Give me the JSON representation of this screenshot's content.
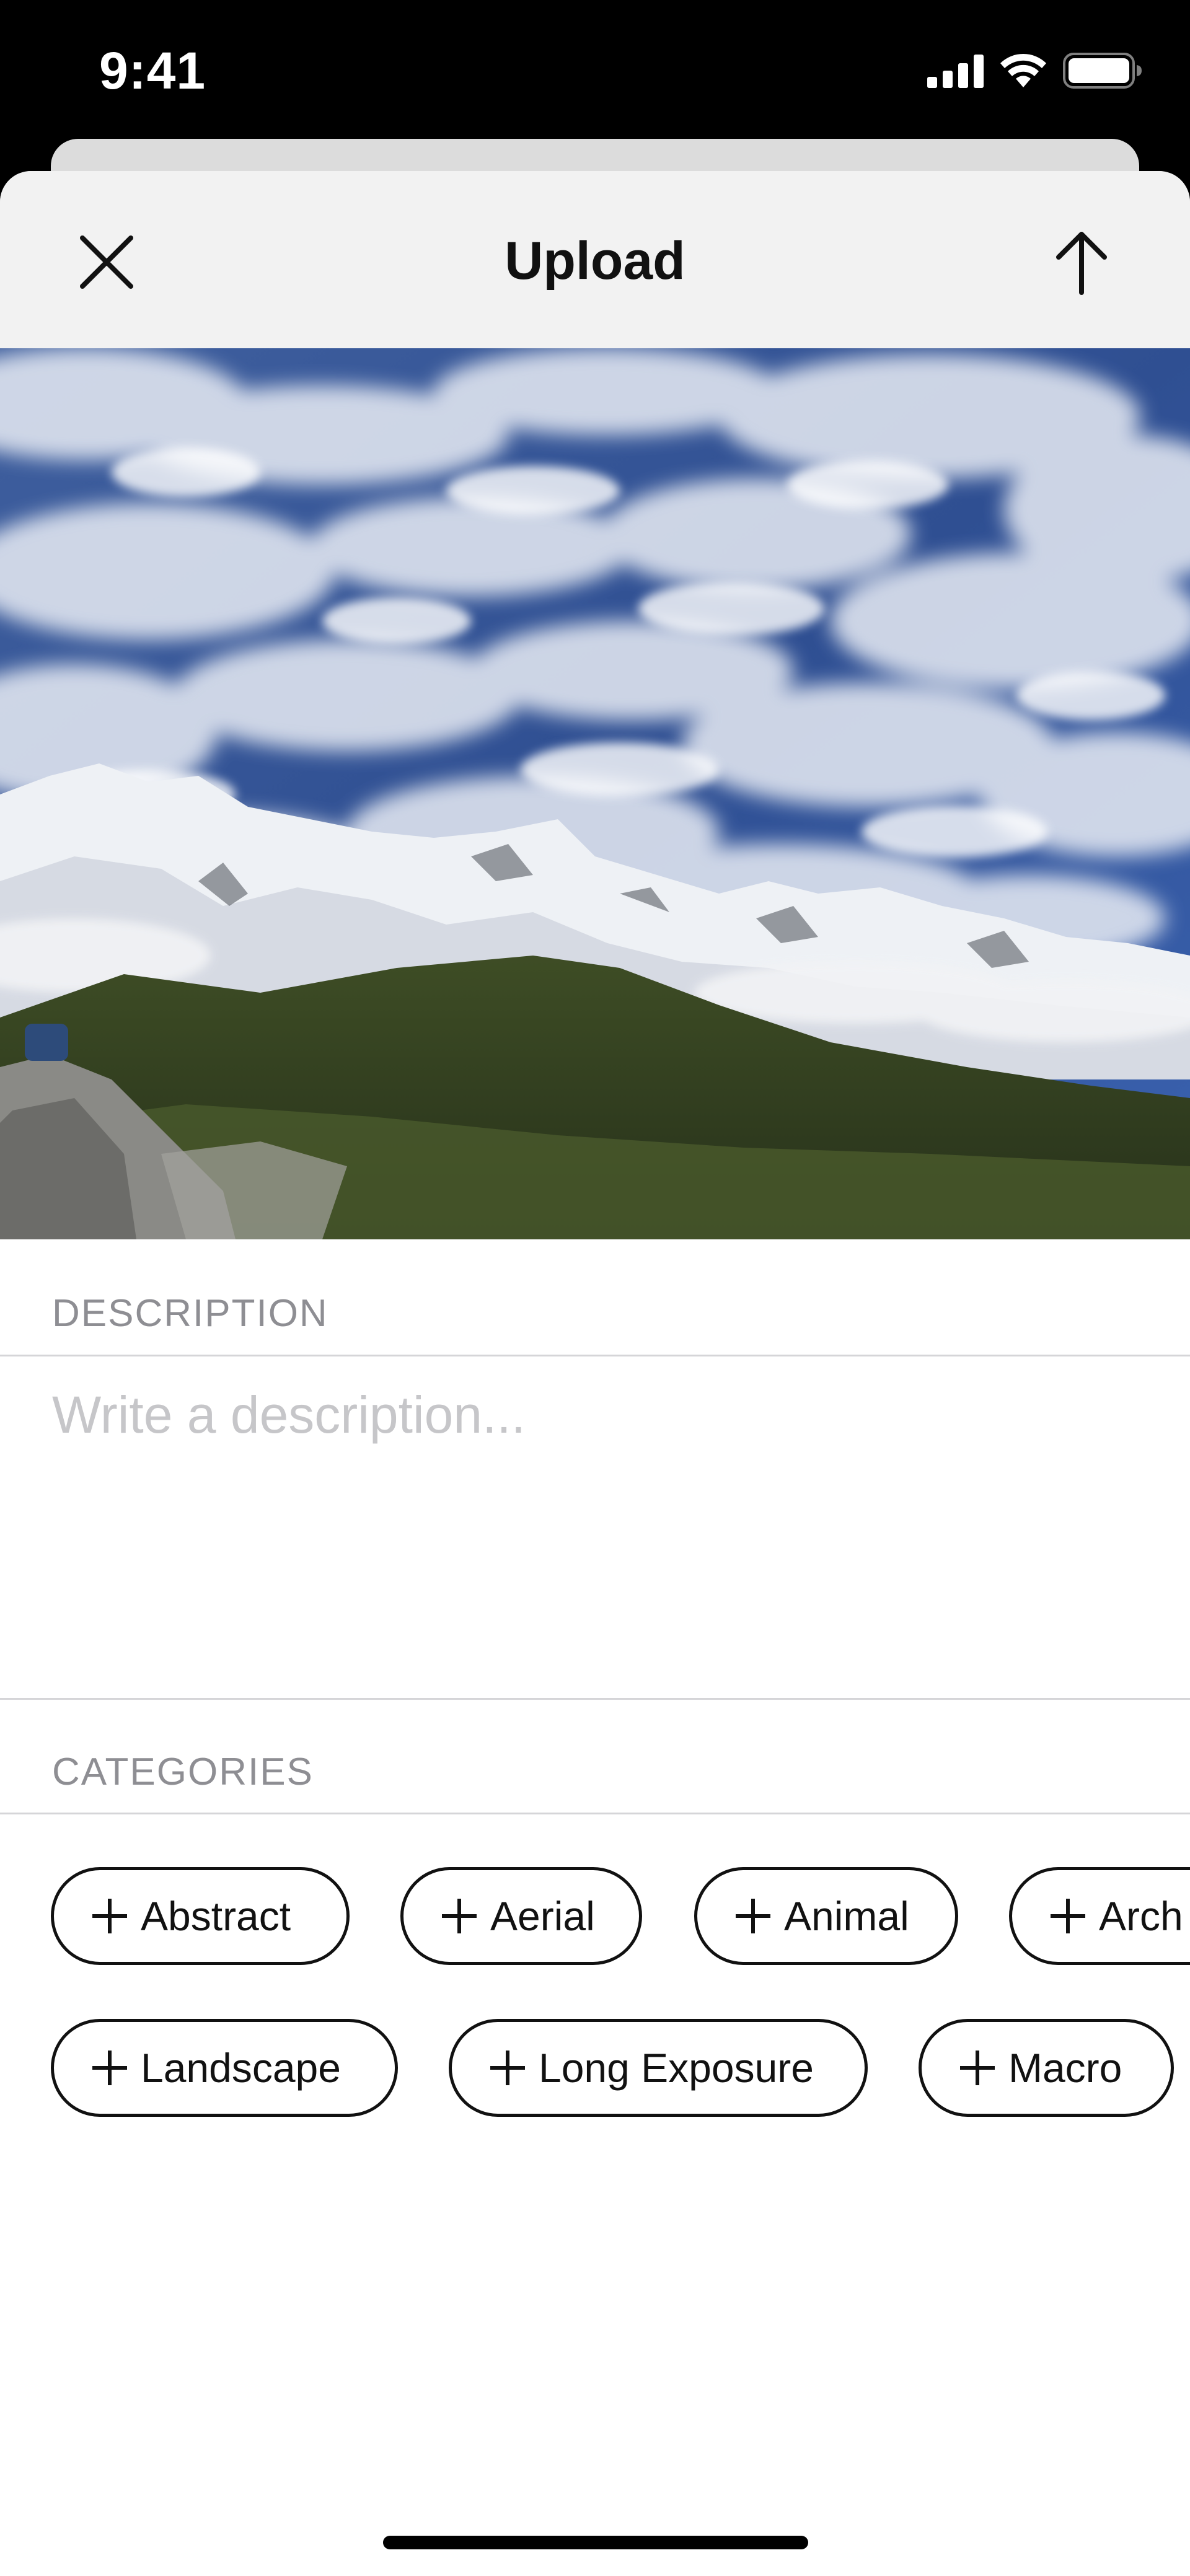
{
  "status_bar": {
    "time": "9:41"
  },
  "nav": {
    "title": "Upload",
    "close_icon": "close-icon",
    "upload_icon": "arrow-up-icon"
  },
  "photo": {
    "subject": "snowy mountain range under a cloudy blue sky"
  },
  "description": {
    "section_label": "DESCRIPTION",
    "placeholder": "Write a description...",
    "value": ""
  },
  "categories": {
    "section_label": "CATEGORIES",
    "row1": [
      "Abstract",
      "Aerial",
      "Animal",
      "Arch"
    ],
    "row2": [
      "Landscape",
      "Long Exposure",
      "Macro"
    ]
  },
  "colors": {
    "nav_background": "#f2f2f2",
    "section_label": "#8e8e93",
    "placeholder": "#c6c6c9"
  }
}
